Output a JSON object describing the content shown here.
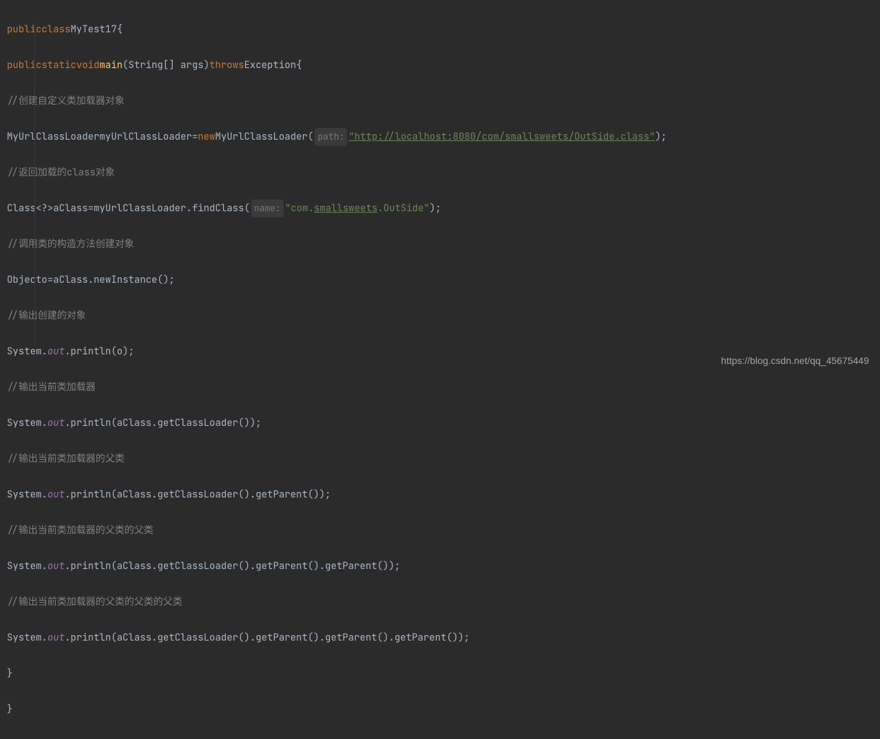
{
  "code": {
    "l1": {
      "kw1": "public",
      "kw2": "class",
      "cls": "MyTest17",
      "brace": "{"
    },
    "l2": {
      "kw1": "public",
      "kw2": "static",
      "kw3": "void",
      "method": "main",
      "params": "(String[] args)",
      "kw4": "throws",
      "exc": "Exception",
      "brace": "{"
    },
    "l3": {
      "slash": "//",
      "comment": "创建自定义类加载器对象"
    },
    "l4": {
      "type": "MyUrlClassLoader",
      "var": "myUrlClassLoader",
      "eq": "=",
      "kw": "new",
      "ctor": "MyUrlClassLoader",
      "lparen": "(",
      "hint": "path:",
      "str": "\"http://localhost:8080/com/smallsweets/OutSide.class\"",
      "rparen": ")",
      "semi": ";"
    },
    "l5": {
      "slash": "//",
      "comment": "返回加载的class对象"
    },
    "l6": {
      "type": "Class<?>",
      "var": "aClass",
      "eq": "=",
      "obj": "myUrlClassLoader",
      "dot": ".",
      "call": "findClass",
      "lparen": "(",
      "hint": "name:",
      "str1": "\"com.",
      "stru": "smallsweets",
      "str2": ".OutSide\"",
      "rparen": ")",
      "semi": ";"
    },
    "l7": {
      "slash": "//",
      "comment": "调用类的构造方法创建对象"
    },
    "l8": {
      "type": "Object",
      "var": "o",
      "eq": "=",
      "obj": "aClass",
      "dot": ".",
      "call": "newInstance",
      "paren": "()",
      "semi": ";"
    },
    "l9": {
      "slash": "//",
      "comment": "输出创建的对象"
    },
    "l10": {
      "sys": "System",
      "dot1": ".",
      "out": "out",
      "dot2": ".",
      "call": "println",
      "lparen": "(",
      "arg": "o",
      "rparen": ")",
      "semi": ";"
    },
    "l11": {
      "slash": "//",
      "comment": "输出当前类加载器"
    },
    "l12": {
      "sys": "System",
      "dot1": ".",
      "out": "out",
      "dot2": ".",
      "call": "println",
      "lparen": "(",
      "arg": "aClass.getClassLoader()",
      "rparen": ")",
      "semi": ";"
    },
    "l13": {
      "slash": "//",
      "comment": "输出当前类加载器的父类"
    },
    "l14": {
      "sys": "System",
      "dot1": ".",
      "out": "out",
      "dot2": ".",
      "call": "println",
      "lparen": "(",
      "arg": "aClass.getClassLoader().getParent()",
      "rparen": ")",
      "semi": ";"
    },
    "l15": {
      "slash": "//",
      "comment": "输出当前类加载器的父类的父类"
    },
    "l16": {
      "sys": "System",
      "dot1": ".",
      "out": "out",
      "dot2": ".",
      "call": "println",
      "lparen": "(",
      "arg": "aClass.getClassLoader().getParent().getParent()",
      "rparen": ")",
      "semi": ";"
    },
    "l17": {
      "slash": "//",
      "comment": "输出当前类加载器的父类的父类的父类"
    },
    "l18": {
      "sys": "System",
      "dot1": ".",
      "out": "out",
      "dot2": ".",
      "call": "println",
      "lparen": "(",
      "arg": "aClass.getClassLoader().getParent().getParent().getParent()",
      "rparen": ")",
      "semi": ";"
    },
    "l19": {
      "brace": "}"
    },
    "l20": {
      "brace": "}"
    }
  },
  "watermark": "https://blog.csdn.net/qq_45675449"
}
